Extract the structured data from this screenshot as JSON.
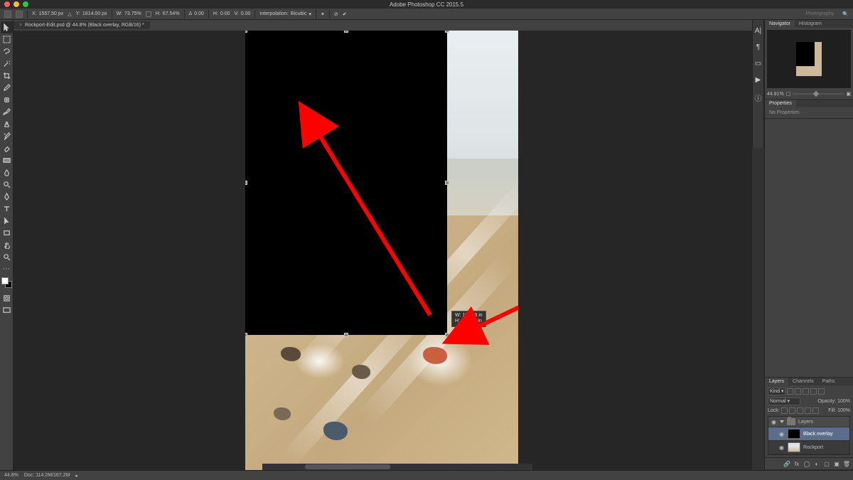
{
  "app": {
    "title": "Adobe Photoshop CC 2015.5"
  },
  "mac_dots": [
    "#ff5f57",
    "#febc2e",
    "#28c840"
  ],
  "options": {
    "x_label": "X:",
    "x_value": "1557.50 px",
    "y_label": "Y:",
    "y_value": "1814.00 px",
    "w_label": "W:",
    "w_value": "73.75%",
    "h_label": "H:",
    "h_value": "67.54%",
    "angle_label": "Δ",
    "angle_value": "0.00",
    "skewh_label": "H:",
    "skewh_value": "0.00",
    "skewv_label": "V:",
    "skewv_value": "0.00",
    "interp_label": "Interpolation:",
    "interp_value": "Bicubic",
    "workspace": "Photography"
  },
  "doc_tab": "Rockport-Edit.psd @ 44.8% (Black overlay, RGB/16) *",
  "tools": [
    "move",
    "rect-marquee",
    "lasso",
    "magic-wand",
    "crop",
    "eyedropper",
    "spot-heal",
    "brush",
    "clone",
    "history-brush",
    "eraser",
    "gradient",
    "blur",
    "dodge",
    "pen",
    "type",
    "path-select",
    "rectangle",
    "hand",
    "zoom"
  ],
  "nav": {
    "tab1": "Navigator",
    "tab2": "Histogram",
    "zoom": "44.81%"
  },
  "props": {
    "tab": "Properties",
    "body": "No Properties"
  },
  "layers_panel": {
    "tab_layers": "Layers",
    "tab_channels": "Channels",
    "tab_paths": "Paths",
    "filter": "Kind",
    "blend": "Normal",
    "opacity_label": "Opacity:",
    "opacity": "100%",
    "lock_label": "Lock:",
    "fill_label": "Fill:",
    "fill": "100%",
    "group": "Layers",
    "layer1": "Black overlay",
    "layer2": "Rockport"
  },
  "dim_readout": {
    "w": "W: 11.063 in",
    "h": "H: 16.452 in"
  },
  "status": {
    "zoom": "44.8%",
    "doc": "Doc: 114.2M/167.2M"
  },
  "right_strip_icons": [
    "char",
    "para",
    "color",
    "swatch",
    "adjust",
    "info"
  ]
}
